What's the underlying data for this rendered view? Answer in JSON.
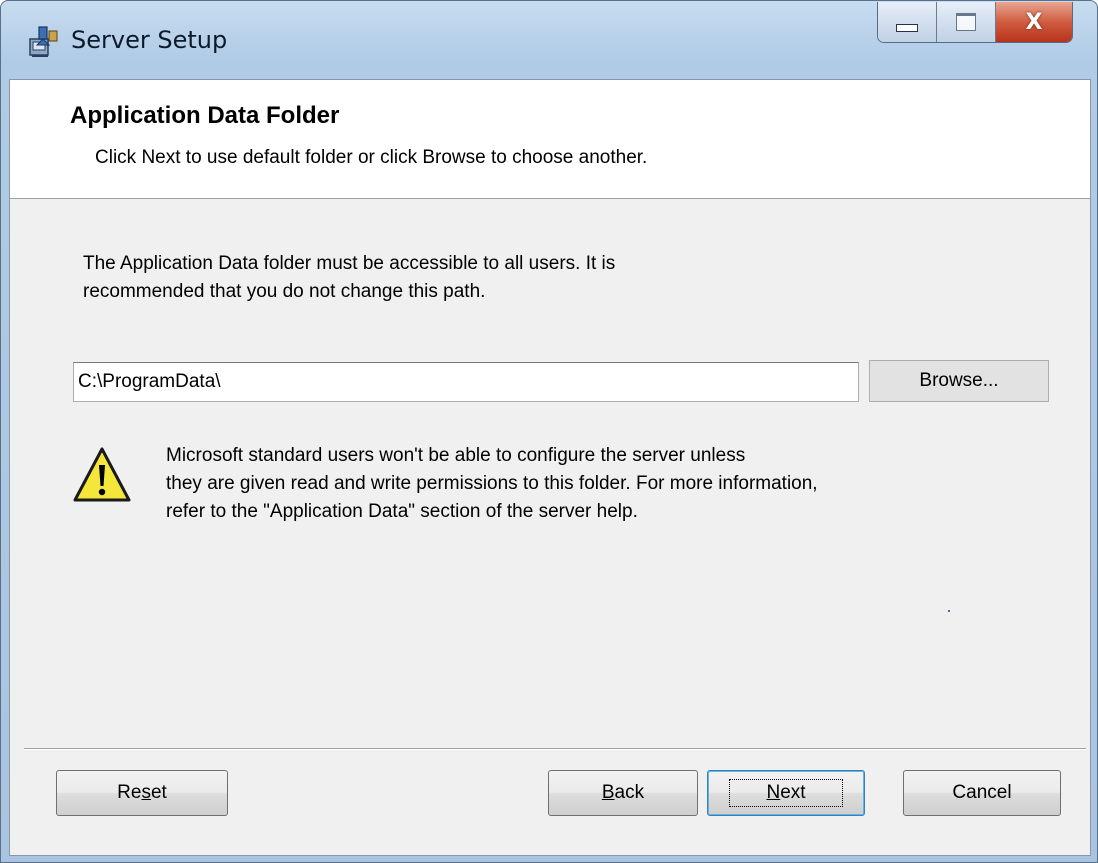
{
  "window": {
    "title": "Server Setup",
    "caption_buttons": {
      "minimize_icon": "minimize-icon",
      "maximize_icon": "maximize-icon",
      "close_label": "X"
    }
  },
  "banner": {
    "title": "Application Data Folder",
    "description": "Click Next to use default folder or click Browse to choose another."
  },
  "body": {
    "info_text": "The Application Data folder must be accessible to all users. It is\nrecommended that you do not change this path.",
    "path_value": "C:\\ProgramData\\",
    "browse_label": "Browse...",
    "warning_icon": "warning-icon",
    "warning_text": "Microsoft standard users won't be able to configure  the server unless\nthey are given read and write permissions to this folder.  For more information,\nrefer to the \"Application Data\" section of the server help."
  },
  "footer": {
    "reset": {
      "before": "Re",
      "mnemonic": "s",
      "after": "et"
    },
    "back": {
      "before": "",
      "mnemonic": "B",
      "after": "ack"
    },
    "next": {
      "before": "",
      "mnemonic": "N",
      "after": "ext"
    },
    "cancel": "Cancel"
  },
  "colors": {
    "titlebar": "#b9d1ea",
    "dialog_background": "#f0f0f0",
    "close_button": "#c7452a",
    "warning_yellow": "#f5e63c"
  }
}
